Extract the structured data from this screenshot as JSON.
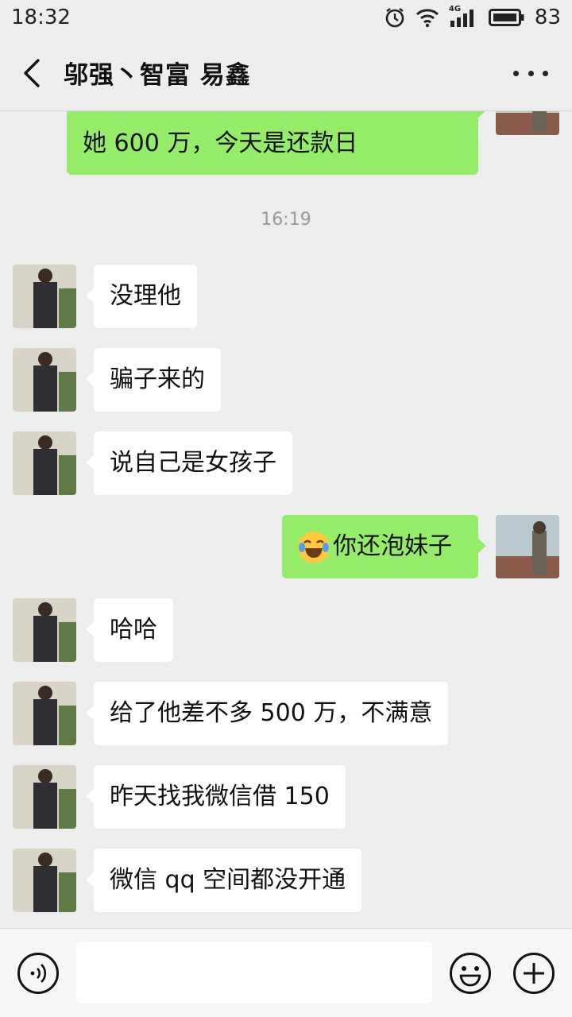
{
  "status_bar": {
    "time": "18:32",
    "network": "4G",
    "battery": "83"
  },
  "nav": {
    "title": "邬强丶智富 易鑫"
  },
  "messages": {
    "m0": "她 600 万，今天是还款日",
    "timestamp": "16:19",
    "m1": "没理他",
    "m2": "骗子来的",
    "m3": "说自己是女孩子",
    "m4_text": "你还泡妹子",
    "m5": "哈哈",
    "m6": "给了他差不多 500 万，不满意",
    "m7": "昨天找我微信借 150",
    "m8": "微信 qq 空间都没开通"
  },
  "input": {
    "placeholder": ""
  },
  "icons": {
    "back": "chevron-left-icon",
    "more": "more-dots-icon",
    "voice": "voice-icon",
    "emoji": "emoji-icon",
    "plus": "plus-icon",
    "emoji_in_message": "tears-of-joy-emoji"
  },
  "colors": {
    "bg": "#ededed",
    "bubble_mine": "#95ec69",
    "bubble_theirs": "#ffffff",
    "timestamp": "#9a9a9a"
  }
}
